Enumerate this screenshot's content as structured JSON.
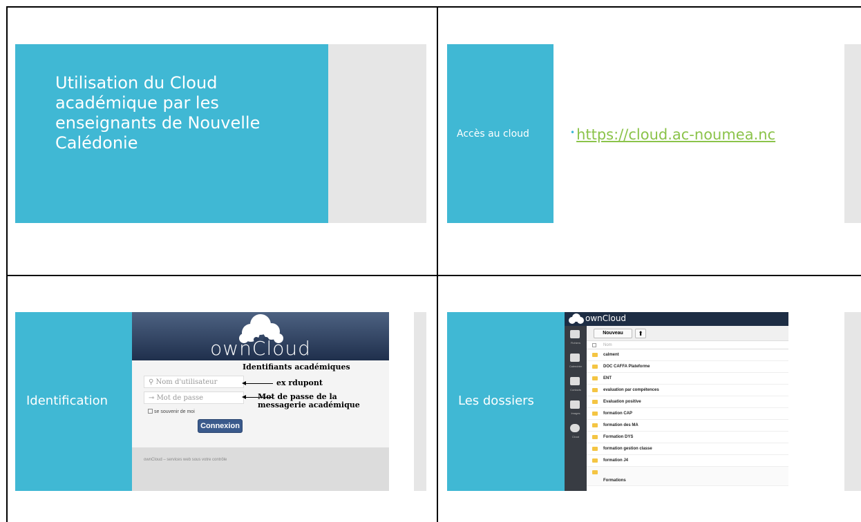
{
  "slide1": {
    "title": "Utilisation du Cloud académique par les enseignants de Nouvelle Calédonie"
  },
  "slide2": {
    "label": "Accès au cloud",
    "bullet": "•",
    "link": "https://cloud.ac-noumea.nc"
  },
  "slide3": {
    "label": "Identification",
    "logo": "ownCloud",
    "heading_annotation": "Identifiants académiques",
    "username_placeholder": "Nom d'utilisateur",
    "username_icon": "user-icon",
    "username_annotation": "ex rdupont",
    "password_placeholder": "Mot de passe",
    "password_icon": "key-icon",
    "password_annotation": "Mot de passe de la messagerie académique",
    "remember_label": "se souvenir de moi",
    "login_button": "Connexion",
    "footer": "ownCloud – services web sous votre contrôle"
  },
  "slide4": {
    "label": "Les dossiers",
    "logo": "ownCloud",
    "new_button": "Nouveau",
    "column_name": "Nom",
    "sidebar": [
      {
        "label": "Fichiers",
        "icon": "folder-icon"
      },
      {
        "label": "Calendrier",
        "icon": "calendar-icon"
      },
      {
        "label": "Contacts",
        "icon": "contacts-icon"
      },
      {
        "label": "Images",
        "icon": "image-icon"
      },
      {
        "label": "Cloud",
        "icon": "globe-icon"
      }
    ],
    "folders": [
      "calment",
      "DOC CAFFA Plateforme",
      "ENT",
      "evaluation par compétences",
      "Evaluation positive",
      "formation CAP",
      "formation des MA",
      "Formation DYS",
      "formation gestion classe",
      "formation J4",
      "Formations"
    ]
  },
  "colors": {
    "accent": "#40b8d4",
    "link": "#8bc34a",
    "panel_gray": "#e6e6e6"
  }
}
